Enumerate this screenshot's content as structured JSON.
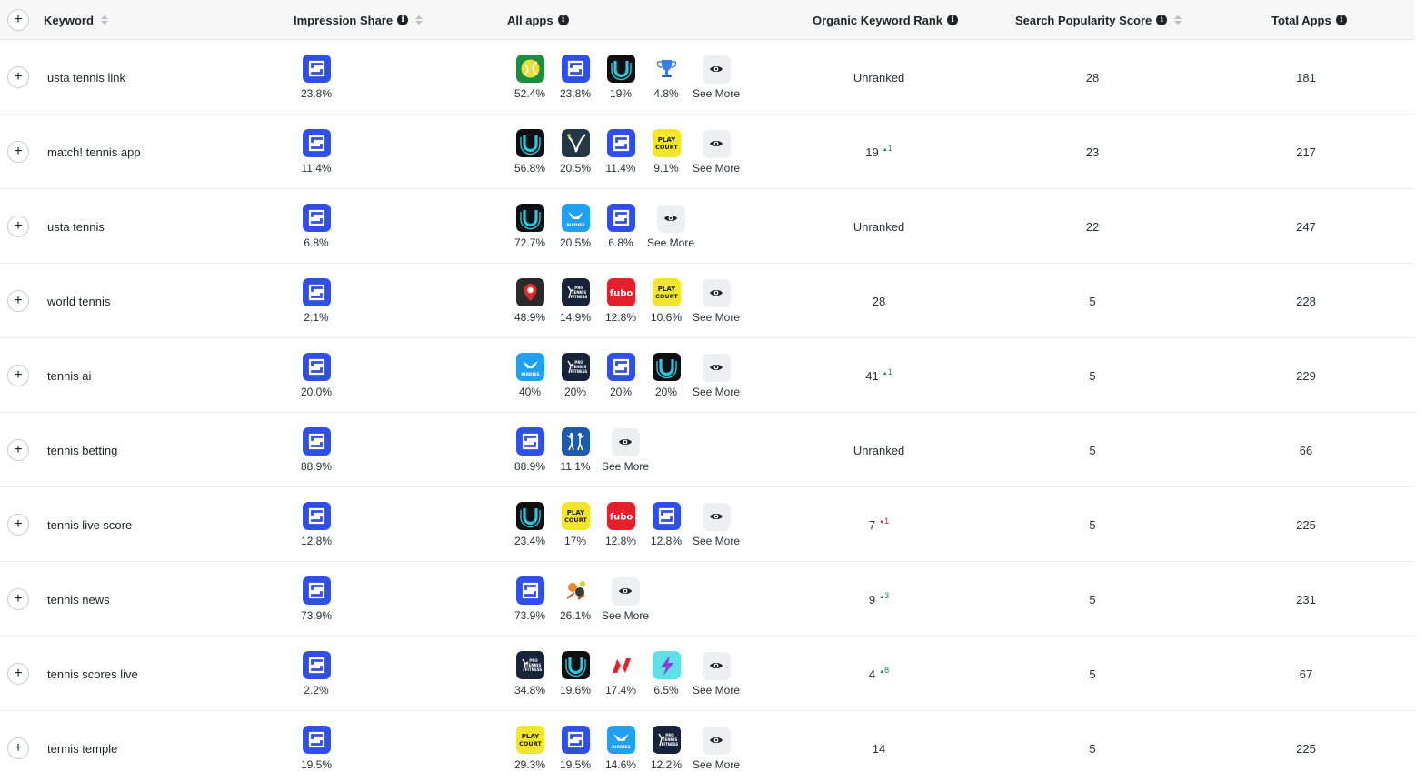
{
  "header": {
    "keyword": "Keyword",
    "impression_share": "Impression Share",
    "all_apps": "All apps",
    "organic_rank": "Organic Keyword Rank",
    "popularity": "Search Popularity Score",
    "total_apps": "Total Apps"
  },
  "see_more_label": "See More",
  "colors": {
    "accent": "#2f4fe6",
    "up": "#1f8a4c",
    "down": "#c0262d"
  },
  "rows": [
    {
      "keyword": "usta tennis link",
      "share": "23.8%",
      "apps": [
        {
          "icon": "tennis-ball-app-icon",
          "pct": "52.4%"
        },
        {
          "icon": "s-logo-app-icon",
          "pct": "23.8%"
        },
        {
          "icon": "u-logo-app-icon",
          "pct": "19%"
        },
        {
          "icon": "trophy-app-icon",
          "pct": "4.8%"
        }
      ],
      "rank": "Unranked",
      "delta": "",
      "delta_dir": "",
      "popularity": "28",
      "total": "181"
    },
    {
      "keyword": "match! tennis app",
      "share": "11.4%",
      "apps": [
        {
          "icon": "u-logo-app-icon",
          "pct": "56.8%"
        },
        {
          "icon": "v-swoosh-app-icon",
          "pct": "20.5%"
        },
        {
          "icon": "s-logo-app-icon",
          "pct": "11.4%"
        },
        {
          "icon": "play-your-court-app-icon",
          "pct": "9.1%"
        }
      ],
      "rank": "19",
      "delta": "1",
      "delta_dir": "up",
      "popularity": "23",
      "total": "217"
    },
    {
      "keyword": "usta tennis",
      "share": "6.8%",
      "apps": [
        {
          "icon": "u-logo-app-icon",
          "pct": "72.7%"
        },
        {
          "icon": "birdies-app-icon",
          "pct": "20.5%"
        },
        {
          "icon": "s-logo-app-icon",
          "pct": "6.8%"
        }
      ],
      "rank": "Unranked",
      "delta": "",
      "delta_dir": "",
      "popularity": "22",
      "total": "247"
    },
    {
      "keyword": "world tennis",
      "share": "2.1%",
      "apps": [
        {
          "icon": "map-pin-app-icon",
          "pct": "48.9%"
        },
        {
          "icon": "pro-tennis-fitness-app-icon",
          "pct": "14.9%"
        },
        {
          "icon": "fubo-app-icon",
          "pct": "12.8%"
        },
        {
          "icon": "play-your-court-app-icon",
          "pct": "10.6%"
        }
      ],
      "rank": "28",
      "delta": "",
      "delta_dir": "",
      "popularity": "5",
      "total": "228"
    },
    {
      "keyword": "tennis ai",
      "share": "20.0%",
      "apps": [
        {
          "icon": "birdies-app-icon",
          "pct": "40%"
        },
        {
          "icon": "pro-tennis-fitness-app-icon",
          "pct": "20%"
        },
        {
          "icon": "s-logo-app-icon",
          "pct": "20%"
        },
        {
          "icon": "u-logo-app-icon",
          "pct": "20%"
        }
      ],
      "rank": "41",
      "delta": "1",
      "delta_dir": "up",
      "popularity": "5",
      "total": "229"
    },
    {
      "keyword": "tennis betting",
      "share": "88.9%",
      "apps": [
        {
          "icon": "s-logo-app-icon",
          "pct": "88.9%"
        },
        {
          "icon": "tennis-players-app-icon",
          "pct": "11.1%"
        }
      ],
      "rank": "Unranked",
      "delta": "",
      "delta_dir": "",
      "popularity": "5",
      "total": "66"
    },
    {
      "keyword": "tennis live score",
      "share": "12.8%",
      "apps": [
        {
          "icon": "u-logo-app-icon",
          "pct": "23.4%"
        },
        {
          "icon": "play-your-court-app-icon",
          "pct": "17%"
        },
        {
          "icon": "fubo-app-icon",
          "pct": "12.8%"
        },
        {
          "icon": "s-logo-app-icon",
          "pct": "12.8%"
        }
      ],
      "rank": "7",
      "delta": "1",
      "delta_dir": "down",
      "popularity": "5",
      "total": "225"
    },
    {
      "keyword": "tennis news",
      "share": "73.9%",
      "apps": [
        {
          "icon": "s-logo-app-icon",
          "pct": "73.9%"
        },
        {
          "icon": "cartoon-tennis-app-icon",
          "pct": "26.1%"
        }
      ],
      "rank": "9",
      "delta": "3",
      "delta_dir": "up",
      "popularity": "5",
      "total": "231"
    },
    {
      "keyword": "tennis scores live",
      "share": "2.2%",
      "apps": [
        {
          "icon": "pro-tennis-fitness-app-icon",
          "pct": "34.8%"
        },
        {
          "icon": "u-logo-app-icon",
          "pct": "19.6%"
        },
        {
          "icon": "n-logo-app-icon",
          "pct": "17.4%"
        },
        {
          "icon": "lightning-app-icon",
          "pct": "6.5%"
        }
      ],
      "rank": "4",
      "delta": "8",
      "delta_dir": "up",
      "popularity": "5",
      "total": "67"
    },
    {
      "keyword": "tennis temple",
      "share": "19.5%",
      "apps": [
        {
          "icon": "play-your-court-app-icon",
          "pct": "29.3%"
        },
        {
          "icon": "s-logo-app-icon",
          "pct": "19.5%"
        },
        {
          "icon": "birdies-app-icon",
          "pct": "14.6%"
        },
        {
          "icon": "pro-tennis-fitness-app-icon",
          "pct": "12.2%"
        }
      ],
      "rank": "14",
      "delta": "",
      "delta_dir": "",
      "popularity": "5",
      "total": "225"
    }
  ]
}
